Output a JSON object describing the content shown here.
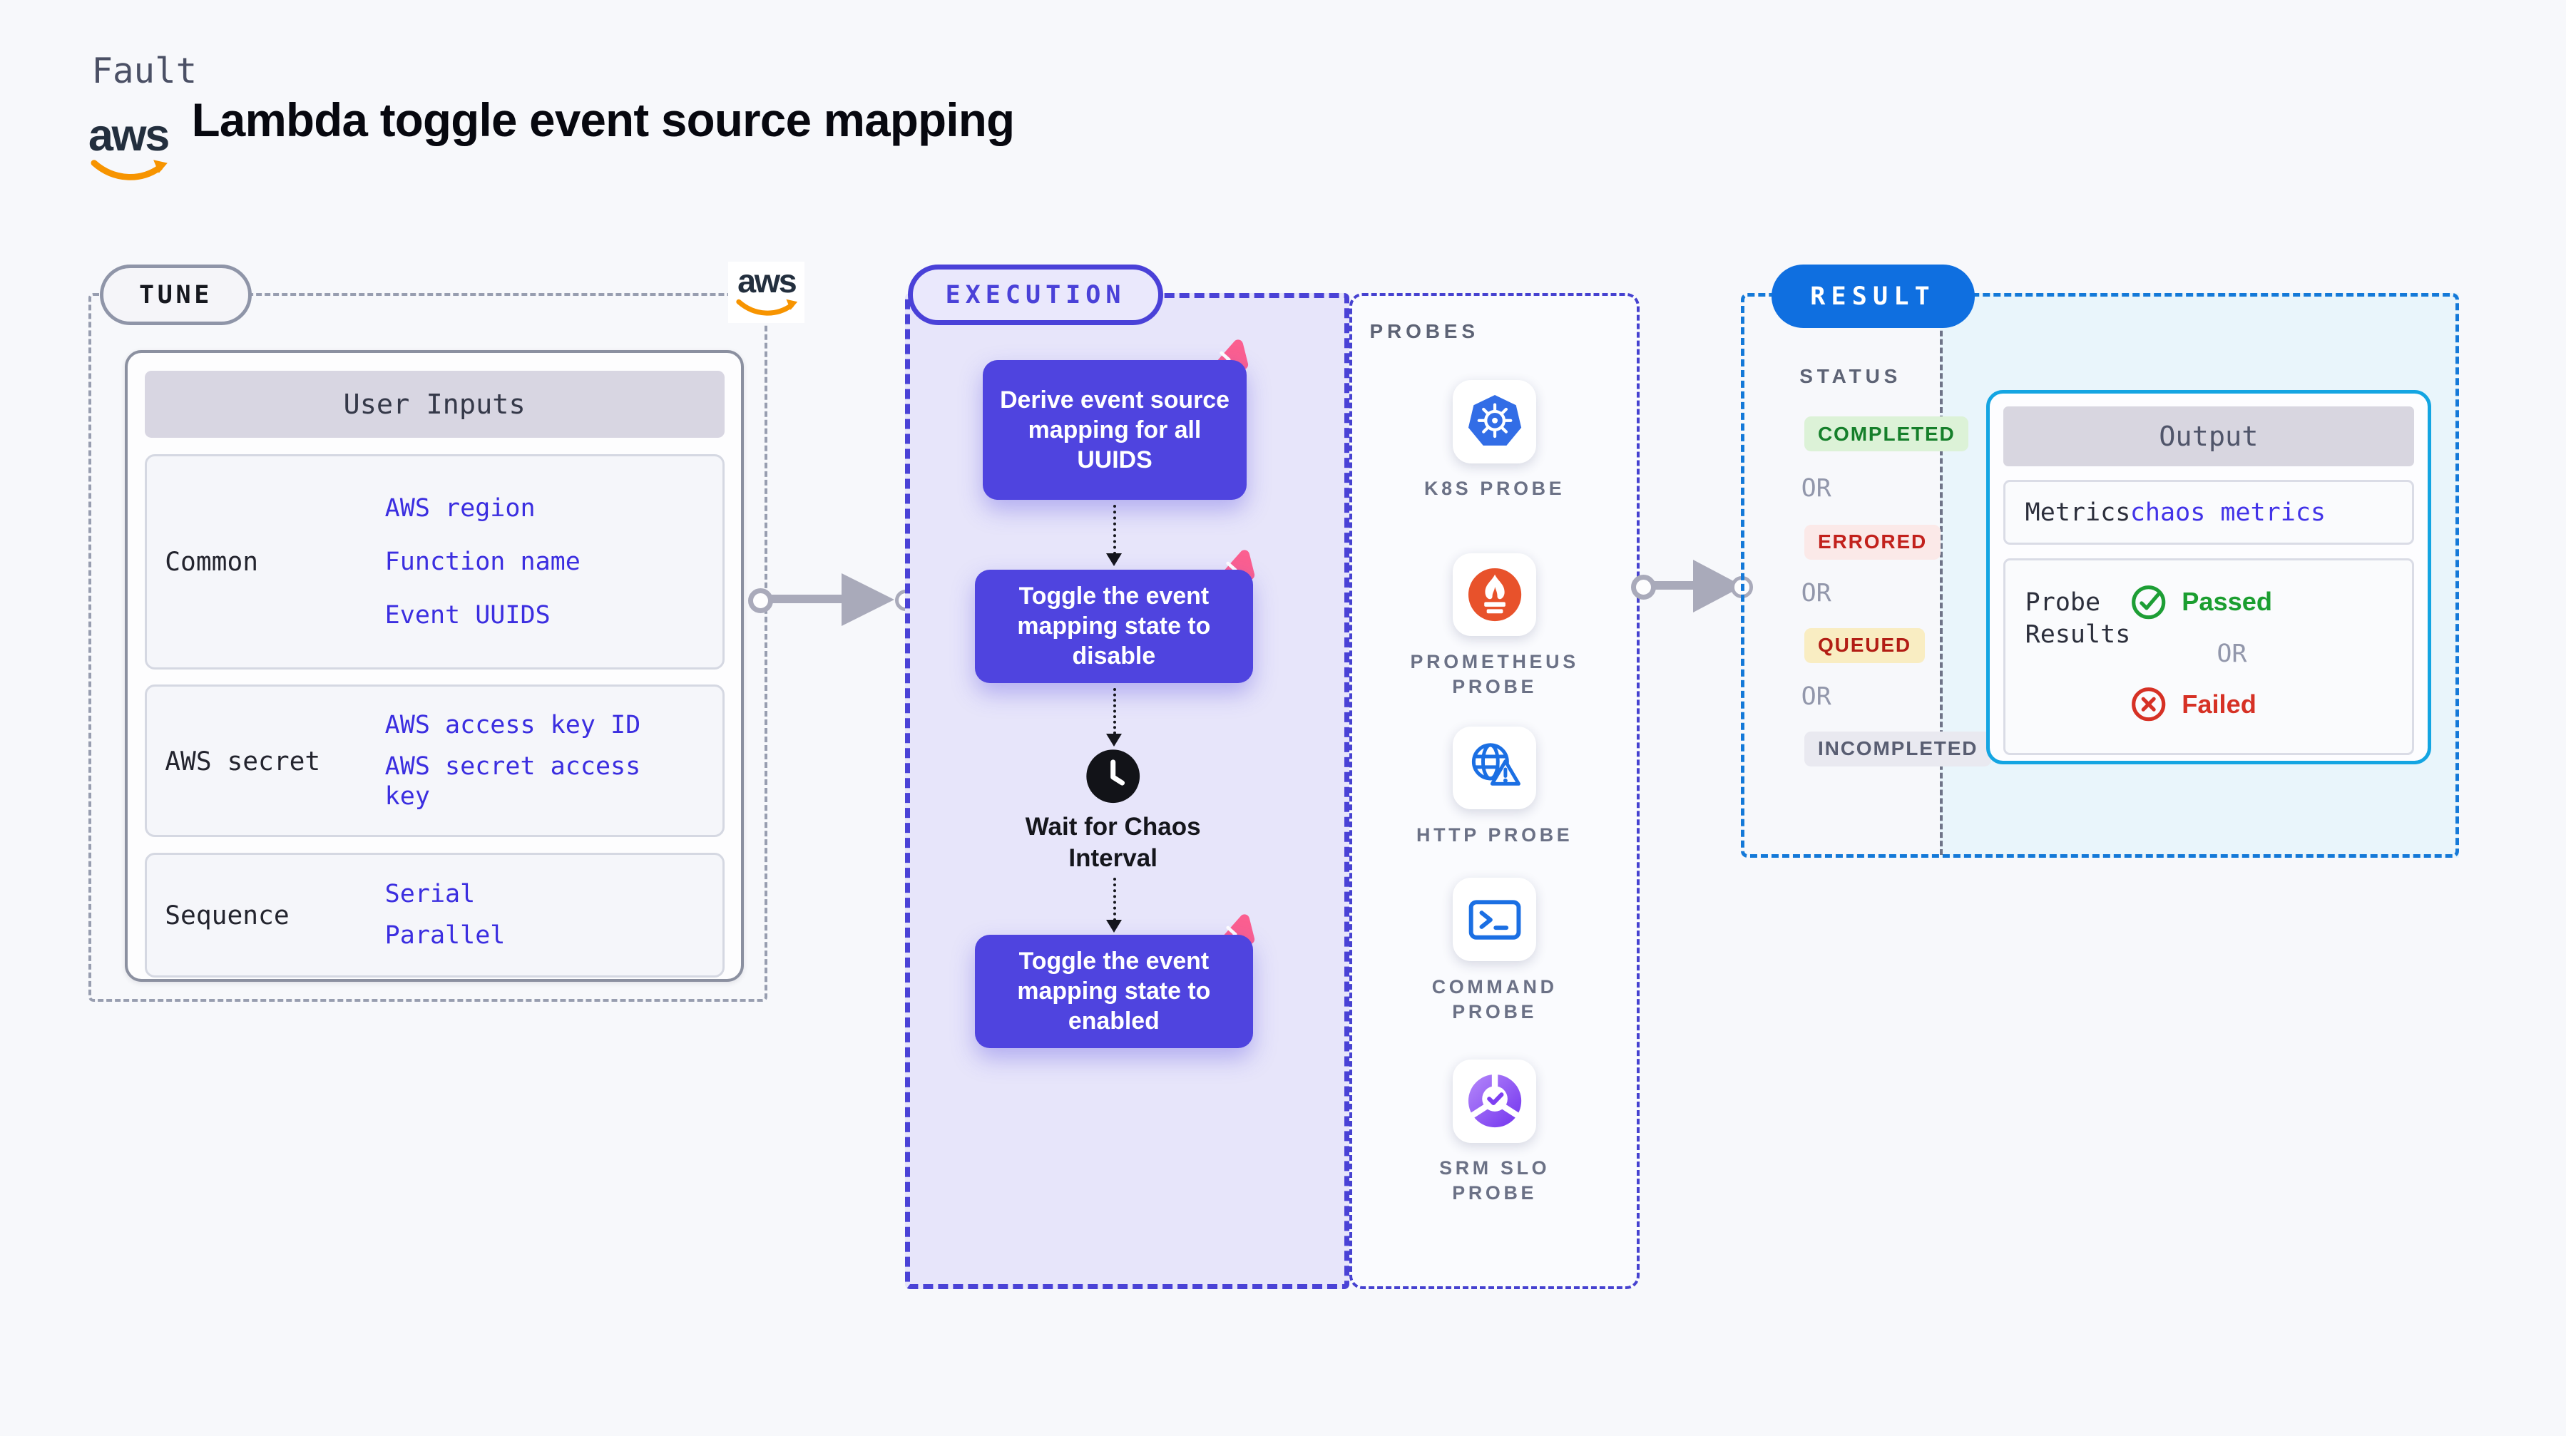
{
  "header": {
    "eyebrow": "Fault",
    "title": "Lambda toggle event source mapping",
    "brand_text": "aws"
  },
  "tune": {
    "badge": "TUNE",
    "table_header": "User Inputs",
    "rows": [
      {
        "label": "Common",
        "values": [
          "AWS region",
          "Function name",
          "Event UUIDS"
        ]
      },
      {
        "label": "AWS secret",
        "values": [
          "AWS access key ID",
          "AWS secret access key"
        ]
      },
      {
        "label": "Sequence",
        "values": [
          "Serial",
          "Parallel"
        ]
      }
    ]
  },
  "execution": {
    "badge": "EXECUTION",
    "step1": "Derive event source mapping for all UUIDS",
    "step2": "Toggle the event mapping state to disable",
    "wait_label": "Wait for Chaos Interval",
    "step3": "Toggle the event mapping state to enabled"
  },
  "probes": {
    "label": "PROBES",
    "items": [
      {
        "label": "K8S PROBE",
        "icon": "kubernetes-icon"
      },
      {
        "label": "PROMETHEUS PROBE",
        "icon": "prometheus-icon"
      },
      {
        "label": "HTTP PROBE",
        "icon": "http-globe-warning-icon"
      },
      {
        "label": "COMMAND PROBE",
        "icon": "terminal-icon"
      },
      {
        "label": "SRM SLO PROBE",
        "icon": "slo-donut-check-icon"
      }
    ]
  },
  "result": {
    "badge": "RESULT",
    "status_label": "STATUS",
    "or_label": "OR",
    "statuses": [
      {
        "label": "COMPLETED",
        "kind": "success"
      },
      {
        "label": "ERRORED",
        "kind": "error"
      },
      {
        "label": "QUEUED",
        "kind": "warning"
      },
      {
        "label": "INCOMPLETED",
        "kind": "neutral"
      }
    ],
    "output": {
      "title": "Output",
      "metrics_label": "Metrics",
      "metrics_value": "chaos metrics",
      "probe_results_label": "Probe Results",
      "passed_label": "Passed",
      "or_label": "OR",
      "failed_label": "Failed"
    }
  },
  "colors": {
    "page_bg": "#f7f8fb",
    "indigo_step": "#4f44df",
    "execution_bg": "#e7e5fa",
    "execution_border": "#4a42d6",
    "tune_border": "#989eb0",
    "probes_border": "#4642d0",
    "result_border": "#1479d8",
    "result_bg": "#e9f5fb",
    "result_pill": "#0f6fe0",
    "output_border": "#14a5e2",
    "link_blue": "#3b2ee0",
    "success_green": "#157f2a",
    "error_red": "#c2211c",
    "warning_bg": "#f9edc2",
    "passed_green": "#1b9e30",
    "failed_red": "#d63125",
    "pink_accent": "#fb5f90",
    "aws_orange": "#f79400",
    "kubernetes_blue": "#326de6",
    "prometheus_orange": "#e8522b"
  }
}
